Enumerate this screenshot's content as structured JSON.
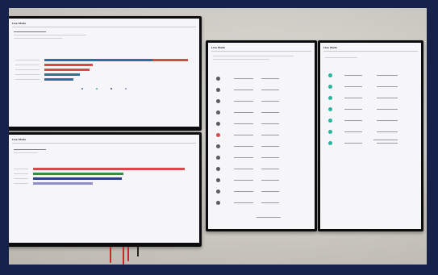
{
  "screens": {
    "top_left": {
      "title": "Live Mode"
    },
    "bottom_left": {
      "title": "Live Mode"
    },
    "portrait_left": {
      "title": "Live Mode"
    },
    "portrait_right": {
      "title": "Live Mode"
    }
  },
  "colors": {
    "bar_blue": "#2f6f9e",
    "bar_red": "#d64a4a",
    "bar_teal": "#2bb5a0",
    "bar_green": "#3c8a3c",
    "bar_navy": "#2d3f8a",
    "bar_lavender": "#8e8ec8",
    "frame": "#17224a"
  }
}
